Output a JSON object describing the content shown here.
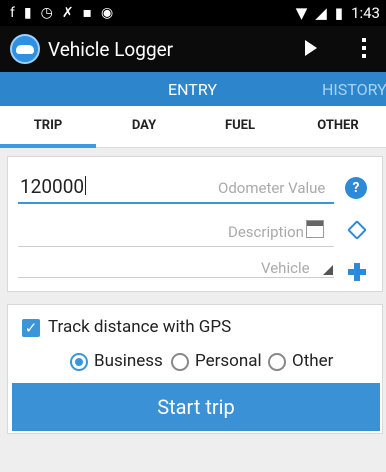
{
  "status_bar": {
    "time": "1:43"
  },
  "app": {
    "title": "Vehicle Logger"
  },
  "top_tabs": {
    "entry": "ENTRY",
    "history": "HISTORY"
  },
  "sub_tabs": [
    "TRIP",
    "DAY",
    "FUEL",
    "OTHER"
  ],
  "form": {
    "odometer_value": "120000",
    "odometer_hint": "Odometer Value",
    "description_hint": "Description",
    "vehicle_hint": "Vehicle",
    "help_label": "?"
  },
  "gps": {
    "checkbox_label": "Track distance with GPS",
    "checked": true,
    "radios": [
      "Business",
      "Personal",
      "Other"
    ],
    "selected": "Business"
  },
  "start_button": "Start trip",
  "colors": {
    "accent": "#3a91d5",
    "tab_bar": "#2d86cc",
    "app_bar": "#0b0b0b"
  }
}
